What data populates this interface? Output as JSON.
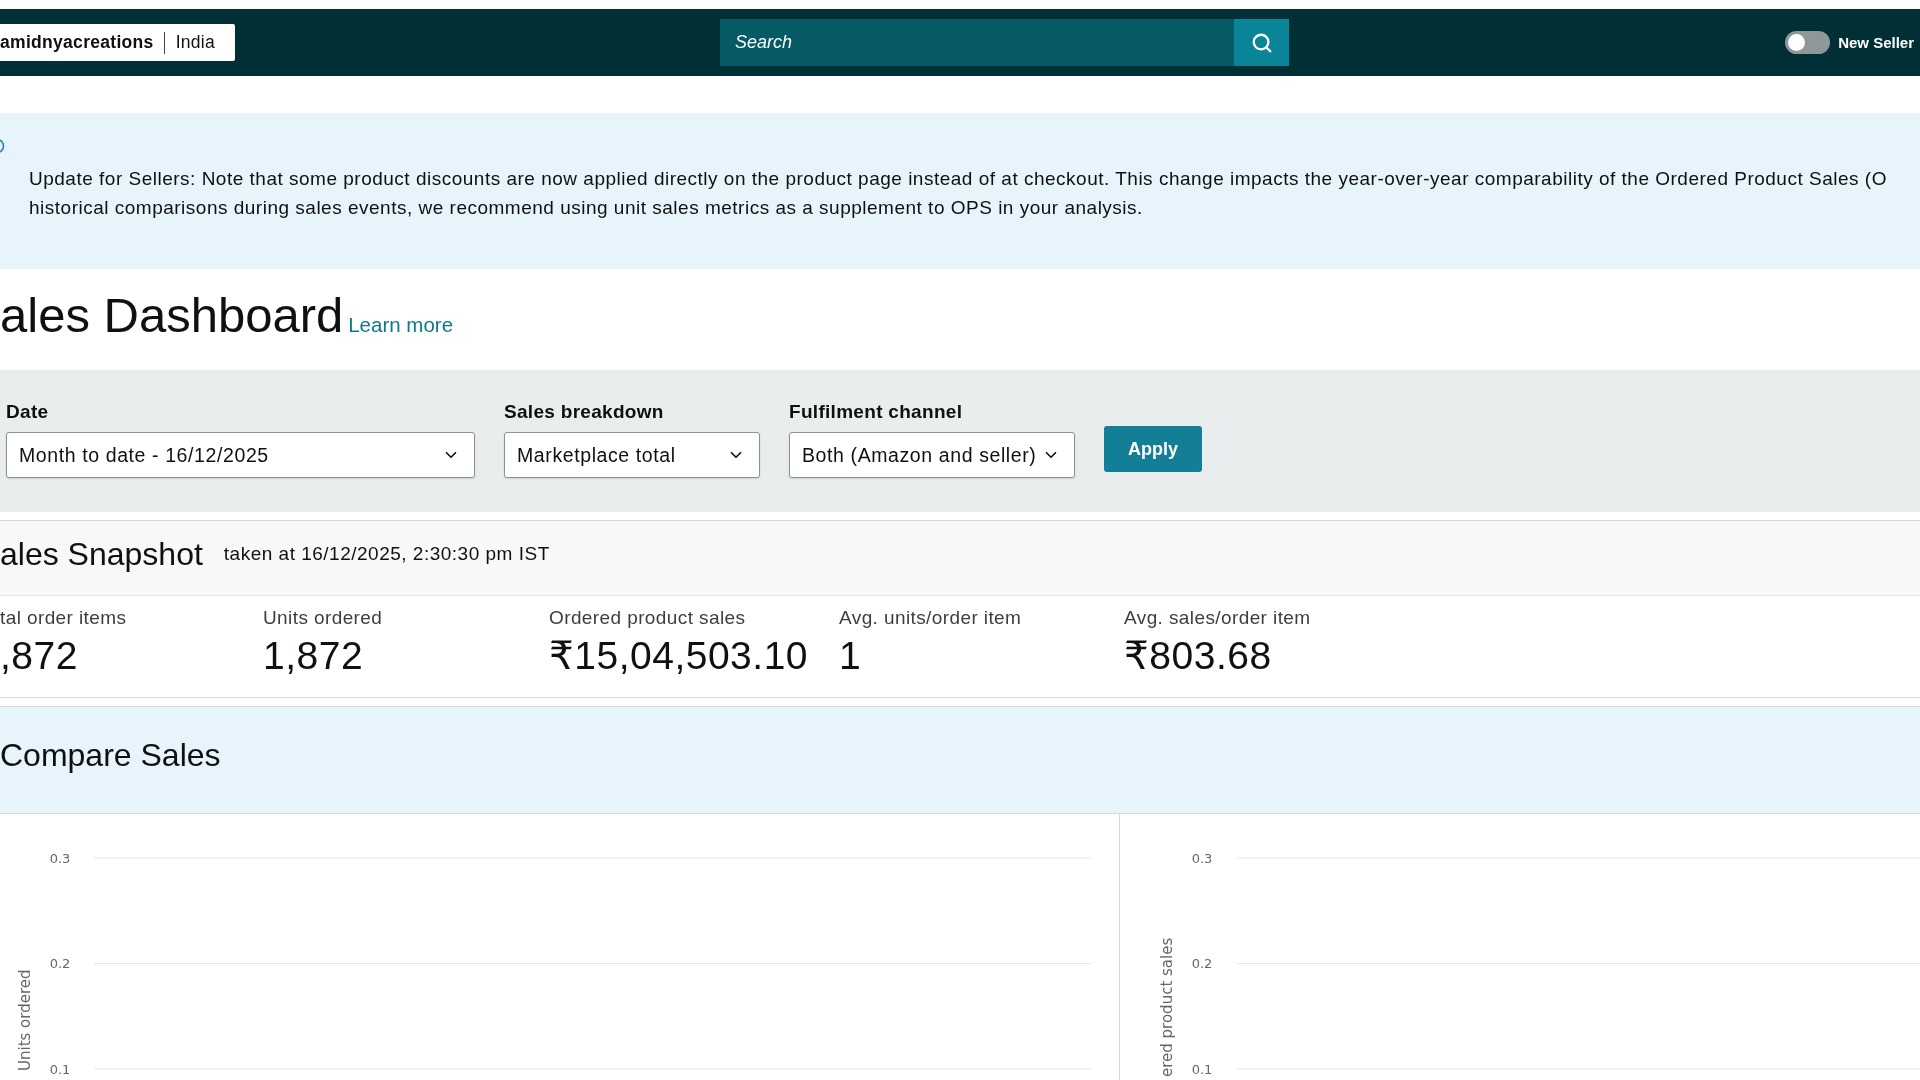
{
  "top_bar": {
    "store": {
      "name": "amidnyacreations",
      "marketplace": "India"
    },
    "search": {
      "placeholder": "Search"
    },
    "new_seller_toggle": {
      "label": "New Seller",
      "on": false
    }
  },
  "notice": {
    "lines": [
      "Update for Sellers: Note that some product discounts are now applied directly on the product page instead of at checkout. This change impacts the year-over-year comparability of the Ordered Product Sales (O",
      "historical comparisons during sales events, we recommend using unit sales metrics as a supplement to OPS in your analysis."
    ]
  },
  "page": {
    "title": "ales Dashboard",
    "learn_more": "Learn more"
  },
  "filters": {
    "fields": [
      {
        "label": "Date",
        "value": "Month to date - 16/12/2025"
      },
      {
        "label": "Sales breakdown",
        "value": "Marketplace total"
      },
      {
        "label": "Fulfilment channel",
        "value": "Both (Amazon and seller)"
      }
    ],
    "apply": "Apply"
  },
  "sales_snapshot": {
    "title": "ales Snapshot",
    "taken_at": "taken at 16/12/2025, 2:30:30 pm IST",
    "metrics": [
      {
        "label": "tal order items",
        "value": ",872"
      },
      {
        "label": "Units ordered",
        "value": "1,872"
      },
      {
        "label": "Ordered product sales",
        "value": "₹15,04,503.10"
      },
      {
        "label": "Avg. units/order item",
        "value": "1"
      },
      {
        "label": "Avg. sales/order item",
        "value": "₹803.68"
      }
    ]
  },
  "compare_sales": {
    "title": "Compare Sales",
    "charts": [
      {
        "y_axis_title": "Units ordered",
        "y_ticks": [
          "0.3",
          "0.2",
          "0.1"
        ]
      },
      {
        "y_axis_title": "ered product sales",
        "y_ticks": [
          "0.3",
          "0.2",
          "0.1"
        ]
      }
    ]
  }
}
